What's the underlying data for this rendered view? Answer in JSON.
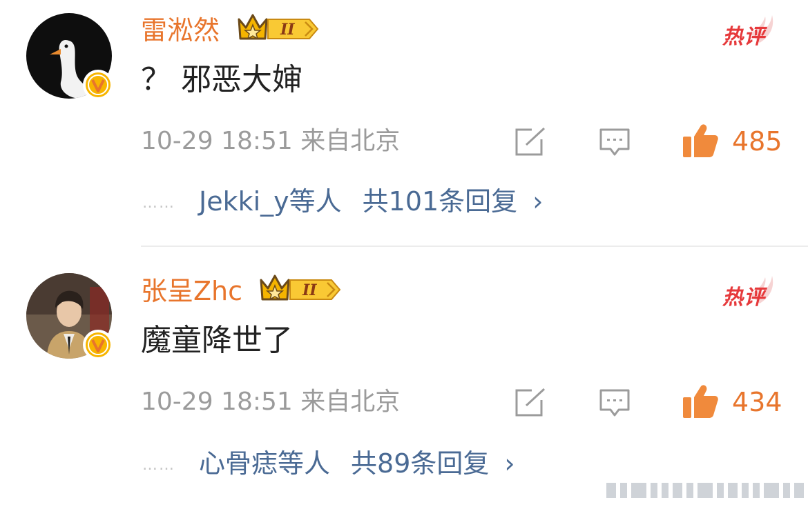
{
  "comments": [
    {
      "username": "雷淞然",
      "level_badge": "II",
      "hot_label": "热评",
      "content": "？ 邪恶大婶",
      "meta": "10-29 18:51 来自北京",
      "likes": "485",
      "replies_prefix": "……",
      "replies_who": "Jekki_y等人",
      "replies_total": "共101条回复",
      "replies_chevron": "›",
      "avatar_icon": "goose-avatar",
      "verified_icon": "verified-v-icon"
    },
    {
      "username": "张呈Zhc",
      "level_badge": "II",
      "hot_label": "热评",
      "content": "魔童降世了",
      "meta": "10-29 18:51 来自北京",
      "likes": "434",
      "replies_prefix": "……",
      "replies_who": "心骨痣等人",
      "replies_total": "共89条回复",
      "replies_chevron": "›",
      "avatar_icon": "person-avatar",
      "verified_icon": "verified-v-icon"
    }
  ],
  "colors": {
    "username": "#e8752c",
    "hot": "#e6393b",
    "link": "#4a6a94",
    "meta": "#9b9b9b",
    "like": "#f08a3c"
  }
}
